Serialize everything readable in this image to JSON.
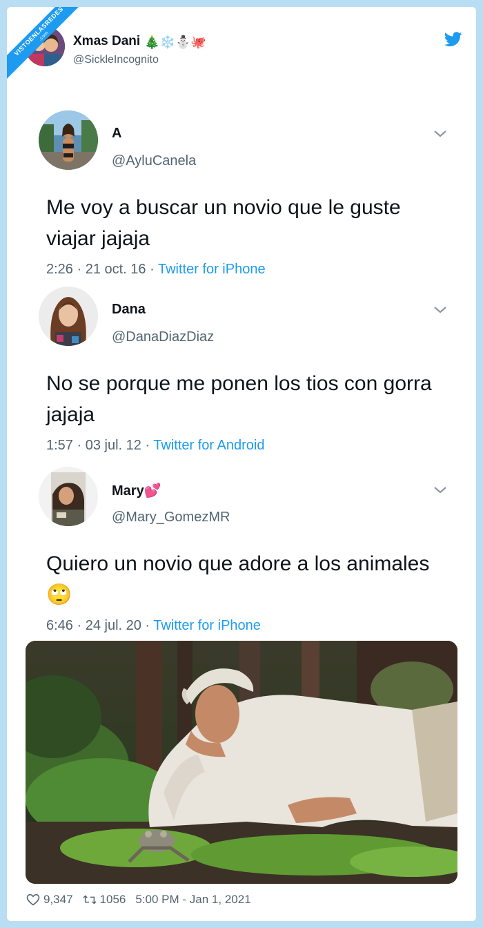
{
  "watermark": {
    "line1": "VISTOENLASREDES",
    "line2": ".com"
  },
  "author": {
    "name": "Xmas Dani",
    "emojis": "🎄❄️⛄🐙",
    "handle": "@SickleIncognito"
  },
  "tweets": [
    {
      "name": "A",
      "handle": "@AyluCanela",
      "text": "Me voy a buscar un novio que le guste viajar jajaja",
      "time": "2:26 · 21 oct. 16 · ",
      "source": "Twitter for iPhone"
    },
    {
      "name": "Dana",
      "handle": "@DanaDiazDiaz",
      "text": "No se porque me ponen los tios con gorra jajaja",
      "time": "1:57 · 03 jul. 12 · ",
      "source": "Twitter for Android"
    },
    {
      "name": "Mary💕",
      "handle": "@Mary_GomezMR",
      "text": "Quiero un novio que adore a los animales 🙄",
      "time": "6:46 · 24 jul. 20 · ",
      "source": "Twitter for iPhone"
    }
  ],
  "footer": {
    "likes": "9,347",
    "retweets": "1056",
    "timestamp": "5:00 PM - Jan 1, 2021"
  },
  "colors": {
    "accent": "#1d9bf0",
    "muted": "#536471",
    "frame": "#b9ddf2"
  }
}
